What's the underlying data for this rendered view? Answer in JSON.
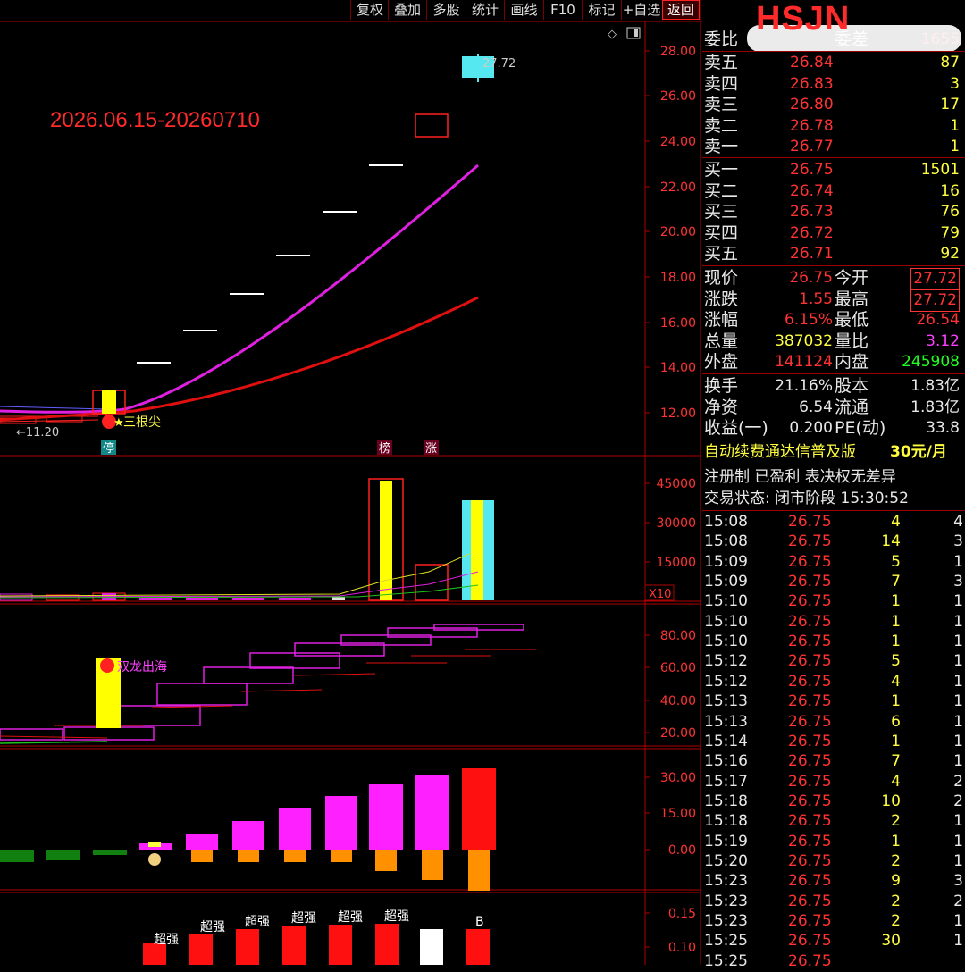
{
  "toolbar": {
    "buttons": [
      "复权",
      "叠加",
      "多股",
      "统计",
      "画线",
      "F10",
      "标记",
      "+自选",
      "返回"
    ]
  },
  "main_chart": {
    "annotation_date": "2026.06.15-20260710",
    "high_label": "27.72",
    "low_label": "←11.20",
    "signal_label": "三根尖",
    "tag_ting": "停",
    "tag_bang": "榜",
    "tag_zhang": "涨",
    "price_ticks": [
      "28.00",
      "26.00",
      "24.00",
      "22.00",
      "20.00",
      "18.00",
      "16.00",
      "14.00",
      "12.00"
    ]
  },
  "volume_panel": {
    "ticks": [
      "45000",
      "30000",
      "15000"
    ],
    "unit": "X10"
  },
  "indicator_panel1": {
    "ticks": [
      "80.00",
      "60.00",
      "40.00",
      "20.00"
    ],
    "signal_label": "双龙出海"
  },
  "indicator_panel2": {
    "ticks": [
      "30.00",
      "15.00",
      "0.00"
    ]
  },
  "indicator_panel3": {
    "ticks": [
      "0.15",
      "0.10"
    ],
    "bar_labels": [
      "超强",
      "超强",
      "超强",
      "超强",
      "超强",
      "超强",
      "",
      "B"
    ]
  },
  "quote": {
    "title": "HSJN",
    "weibi_label": "委比",
    "weicha_label": "委差",
    "weicha_value": "1655",
    "asks": [
      {
        "label": "卖五",
        "price": "26.84",
        "vol": "87"
      },
      {
        "label": "卖四",
        "price": "26.83",
        "vol": "3"
      },
      {
        "label": "卖三",
        "price": "26.80",
        "vol": "17"
      },
      {
        "label": "卖二",
        "price": "26.78",
        "vol": "1"
      },
      {
        "label": "卖一",
        "price": "26.77",
        "vol": "1"
      }
    ],
    "bids": [
      {
        "label": "买一",
        "price": "26.75",
        "vol": "1501"
      },
      {
        "label": "买二",
        "price": "26.74",
        "vol": "16"
      },
      {
        "label": "买三",
        "price": "26.73",
        "vol": "76"
      },
      {
        "label": "买四",
        "price": "26.72",
        "vol": "79"
      },
      {
        "label": "买五",
        "price": "26.71",
        "vol": "92"
      }
    ],
    "stats": [
      {
        "l1": "现价",
        "v1": "26.75",
        "l2": "今开",
        "v2": "27.72"
      },
      {
        "l1": "涨跌",
        "v1": "1.55",
        "l2": "最高",
        "v2": "27.72"
      },
      {
        "l1": "涨幅",
        "v1": "6.15%",
        "l2": "最低",
        "v2": "26.54"
      },
      {
        "l1": "总量",
        "v1": "387032",
        "l2": "量比",
        "v2": "3.12"
      },
      {
        "l1": "外盘",
        "v1": "141124",
        "l2": "内盘",
        "v2": "245908"
      }
    ],
    "fin": [
      {
        "l1": "换手",
        "v1": "21.16%",
        "l2": "股本",
        "v2": "1.83亿"
      },
      {
        "l1": "净资",
        "v1": "6.54",
        "l2": "流通",
        "v2": "1.83亿"
      },
      {
        "l1": "收益(一)",
        "v1": "0.200",
        "l2": "PE(动)",
        "v2": "33.8"
      }
    ],
    "promo": "自动续费通达信普及版",
    "promo_price": "30元/月",
    "reg_info": "注册制 已盈利 表决权无差异",
    "trade_status": "交易状态: 闭市阶段 15:30:52",
    "ticks": [
      {
        "t": "15:08",
        "p": "26.75",
        "v": "4",
        "n": "4"
      },
      {
        "t": "15:08",
        "p": "26.75",
        "v": "14",
        "n": "3"
      },
      {
        "t": "15:09",
        "p": "26.75",
        "v": "5",
        "n": "1"
      },
      {
        "t": "15:09",
        "p": "26.75",
        "v": "7",
        "n": "3"
      },
      {
        "t": "15:10",
        "p": "26.75",
        "v": "1",
        "n": "1"
      },
      {
        "t": "15:10",
        "p": "26.75",
        "v": "1",
        "n": "1"
      },
      {
        "t": "15:10",
        "p": "26.75",
        "v": "1",
        "n": "1"
      },
      {
        "t": "15:12",
        "p": "26.75",
        "v": "5",
        "n": "1"
      },
      {
        "t": "15:12",
        "p": "26.75",
        "v": "4",
        "n": "1"
      },
      {
        "t": "15:13",
        "p": "26.75",
        "v": "1",
        "n": "1"
      },
      {
        "t": "15:13",
        "p": "26.75",
        "v": "6",
        "n": "1"
      },
      {
        "t": "15:14",
        "p": "26.75",
        "v": "1",
        "n": "1"
      },
      {
        "t": "15:16",
        "p": "26.75",
        "v": "7",
        "n": "1"
      },
      {
        "t": "15:17",
        "p": "26.75",
        "v": "4",
        "n": "2"
      },
      {
        "t": "15:18",
        "p": "26.75",
        "v": "10",
        "n": "2"
      },
      {
        "t": "15:18",
        "p": "26.75",
        "v": "2",
        "n": "1"
      },
      {
        "t": "15:19",
        "p": "26.75",
        "v": "1",
        "n": "1"
      },
      {
        "t": "15:20",
        "p": "26.75",
        "v": "2",
        "n": "1"
      },
      {
        "t": "15:23",
        "p": "26.75",
        "v": "9",
        "n": "3"
      },
      {
        "t": "15:23",
        "p": "26.75",
        "v": "2",
        "n": "2"
      },
      {
        "t": "15:23",
        "p": "26.75",
        "v": "2",
        "n": "1"
      },
      {
        "t": "15:25",
        "p": "26.75",
        "v": "30",
        "n": "1"
      },
      {
        "t": "15:25",
        "p": "26.75",
        "v": "",
        "n": ""
      }
    ]
  }
}
